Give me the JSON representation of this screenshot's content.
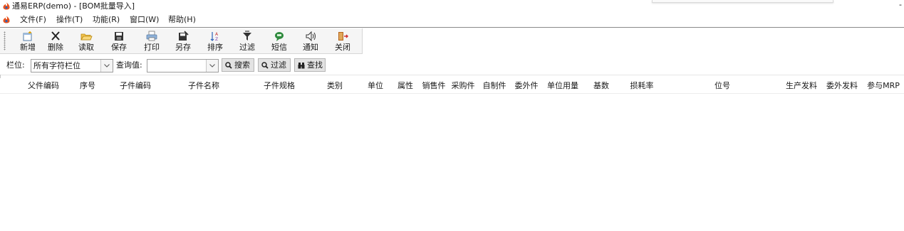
{
  "window": {
    "title": "通易ERP(demo) - [BOM批量导入]",
    "minimize_symbol": "-"
  },
  "menu": [
    {
      "label": "文件(F)"
    },
    {
      "label": "操作(T)"
    },
    {
      "label": "功能(R)"
    },
    {
      "label": "窗口(W)"
    },
    {
      "label": "帮助(H)"
    }
  ],
  "toolbar": [
    {
      "label": "新增",
      "icon": "new-icon"
    },
    {
      "label": "删除",
      "icon": "delete-icon"
    },
    {
      "label": "读取",
      "icon": "open-folder-icon"
    },
    {
      "label": "保存",
      "icon": "save-icon"
    },
    {
      "label": "打印",
      "icon": "print-icon"
    },
    {
      "label": "另存",
      "icon": "save-as-icon"
    },
    {
      "label": "排序",
      "icon": "sort-icon"
    },
    {
      "label": "过滤",
      "icon": "filter-icon"
    },
    {
      "label": "短信",
      "icon": "sms-icon"
    },
    {
      "label": "通知",
      "icon": "speaker-icon"
    },
    {
      "label": "关闭",
      "icon": "exit-icon"
    }
  ],
  "filter": {
    "field_label": "栏位:",
    "field_value": "所有字符栏位",
    "query_label": "查询值:",
    "query_value": "",
    "search_label": "搜索",
    "filter_label": "过滤",
    "find_label": "查找"
  },
  "columns": [
    "父件编码",
    "序号",
    "子件编码",
    "子件名称",
    "子件规格",
    "类别",
    "单位",
    "属性",
    "销售件",
    "采购件",
    "自制件",
    "委外件",
    "单位用量",
    "基数",
    "损耗率",
    "位号",
    "生产发料",
    "委外发料",
    "参与MRP"
  ],
  "colors": {
    "toolbar_bg": "#f5f5f5",
    "button_bg": "#e3e3e3",
    "app_icon": "#e8531e"
  }
}
